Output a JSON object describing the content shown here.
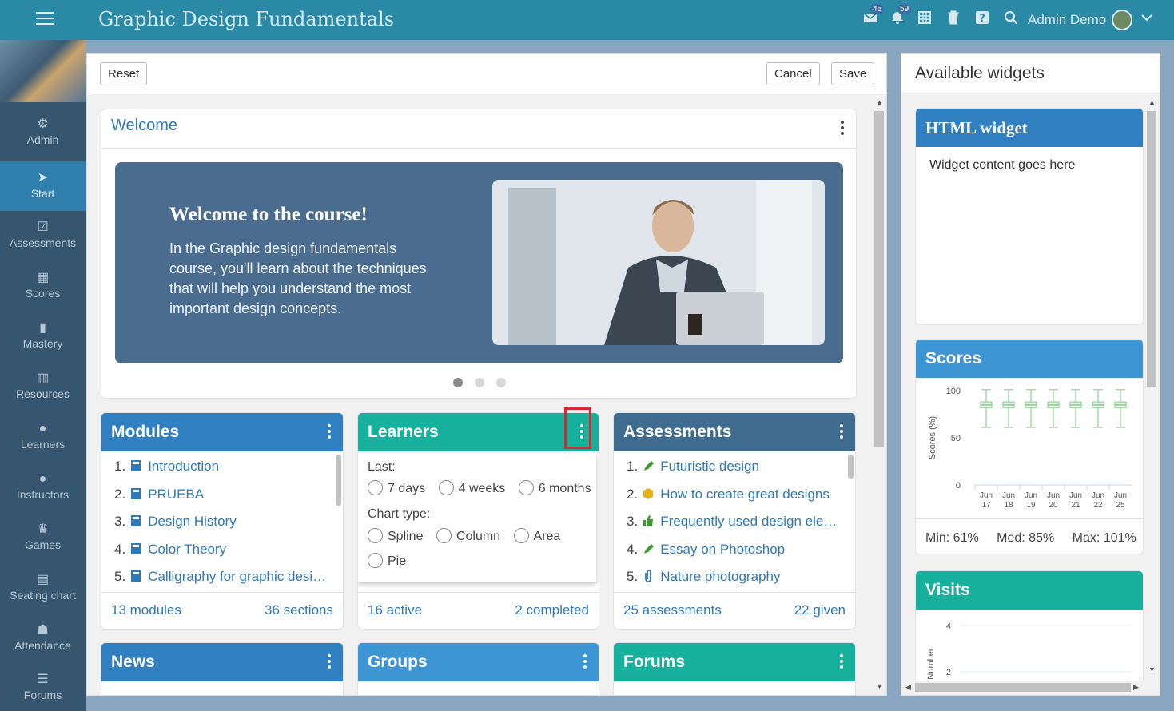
{
  "header": {
    "title": "Graphic Design Fundamentals",
    "messages_badge": "45",
    "notifications_badge": "59",
    "user_name": "Admin Demo"
  },
  "sidebar": {
    "items": [
      {
        "label": "Admin",
        "icon": "gear-icon"
      },
      {
        "label": "Start",
        "icon": "navigation-arrow-icon"
      },
      {
        "label": "Assessments",
        "icon": "checkbox-icon"
      },
      {
        "label": "Scores",
        "icon": "table-icon"
      },
      {
        "label": "Mastery",
        "icon": "bar-chart-icon"
      },
      {
        "label": "Resources",
        "icon": "books-icon"
      },
      {
        "label": "Learners",
        "icon": "person-icon"
      },
      {
        "label": "Instructors",
        "icon": "instructor-icon"
      },
      {
        "label": "Games",
        "icon": "trophy-icon"
      },
      {
        "label": "Seating chart",
        "icon": "seating-icon"
      },
      {
        "label": "Attendance",
        "icon": "attendance-icon"
      },
      {
        "label": "Forums",
        "icon": "list-icon"
      }
    ]
  },
  "toolbar": {
    "reset_label": "Reset",
    "cancel_label": "Cancel",
    "save_label": "Save"
  },
  "welcome": {
    "title": "Welcome",
    "heading": "Welcome to the course!",
    "body": "In the Graphic design fundamentals course, you'll learn about the techniques that will help you understand the most important design concepts."
  },
  "modules": {
    "title": "Modules",
    "items": [
      {
        "num": "1.",
        "label": "Introduction"
      },
      {
        "num": "2.",
        "label": "PRUEBA"
      },
      {
        "num": "3.",
        "label": "Design History"
      },
      {
        "num": "4.",
        "label": "Color Theory"
      },
      {
        "num": "5.",
        "label": "Calligraphy for graphic desi…"
      }
    ],
    "footer_left": "13 modules",
    "footer_right": "36 sections"
  },
  "learners": {
    "title": "Learners",
    "last_label": "Last:",
    "period_options": [
      "7 days",
      "4 weeks",
      "6 months"
    ],
    "chart_type_label": "Chart type:",
    "chart_options": [
      "Spline",
      "Column",
      "Area",
      "Pie"
    ],
    "footer_left": "16 active",
    "footer_right": "2 completed"
  },
  "assessments": {
    "title": "Assessments",
    "items": [
      {
        "num": "1.",
        "label": "Futuristic design"
      },
      {
        "num": "2.",
        "label": "How to create great designs"
      },
      {
        "num": "3.",
        "label": "Frequently used design ele…"
      },
      {
        "num": "4.",
        "label": "Essay on Photoshop"
      },
      {
        "num": "5.",
        "label": "Nature photography"
      }
    ],
    "footer_left": "25 assessments",
    "footer_right": "22 given"
  },
  "news": {
    "title": "News"
  },
  "groups": {
    "title": "Groups"
  },
  "forums": {
    "title": "Forums"
  },
  "available": {
    "title": "Available widgets",
    "html_widget": {
      "title": "HTML widget",
      "content": "Widget content goes here"
    },
    "scores": {
      "title": "Scores",
      "ylabel": "Scores (%)",
      "stats": {
        "min": "Min: 61%",
        "med": "Med: 85%",
        "max": "Max: 101%"
      }
    },
    "visits": {
      "title": "Visits",
      "ylabel": "Number"
    }
  },
  "chart_data": [
    {
      "type": "box",
      "title": "Scores",
      "ylabel": "Scores (%)",
      "ylim": [
        0,
        100
      ],
      "yticks": [
        0,
        50,
        100
      ],
      "categories": [
        "Jun 17",
        "Jun 18",
        "Jun 19",
        "Jun 20",
        "Jun 21",
        "Jun 22",
        "Jun 25"
      ],
      "series": [
        {
          "low": [
            61,
            61,
            61,
            61,
            61,
            61,
            61
          ],
          "q1": [
            82,
            82,
            82,
            82,
            82,
            82,
            82
          ],
          "median": [
            85,
            85,
            85,
            85,
            85,
            85,
            85
          ],
          "q3": [
            88,
            88,
            88,
            88,
            88,
            88,
            88
          ],
          "high": [
            101,
            101,
            101,
            101,
            101,
            101,
            101
          ]
        }
      ],
      "color": "#8fd18f"
    },
    {
      "type": "line",
      "title": "Visits",
      "ylabel": "Number",
      "yticks": [
        2,
        4
      ]
    }
  ]
}
